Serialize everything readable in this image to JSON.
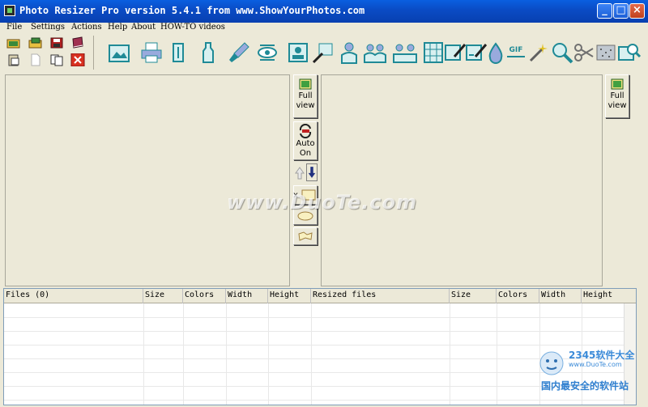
{
  "window": {
    "title": "Photo Resizer Pro version 5.4.1 from www.ShowYourPhotos.com",
    "controls": {
      "minimize": "_",
      "maximize": "□",
      "close": "×"
    }
  },
  "menu": {
    "items": [
      {
        "label": "File",
        "mnemonic": "F"
      },
      {
        "label": "Settings",
        "mnemonic": "S"
      },
      {
        "label": "Actions",
        "mnemonic": "A"
      },
      {
        "label": "Help",
        "mnemonic": "H"
      },
      {
        "label": "About",
        "mnemonic": "A"
      },
      {
        "label": "HOW-TO videos",
        "mnemonic": "H"
      }
    ]
  },
  "toolbar": {
    "small_icons": [
      "open-folder-icon",
      "open-multiple-icon",
      "save-icon",
      "book-icon",
      "paste-icon",
      "new-file-icon",
      "copy-icon",
      "delete-icon"
    ],
    "big_icons": [
      "picture-frame-icon",
      "printer-icon",
      "resize-vertical-icon",
      "bottle-icon",
      "brush-icon",
      "rotate-eye-icon",
      "photo-adjust-icon",
      "photo-edit-icon",
      "people-icon",
      "group-photo-icon",
      "group-photo-wide-icon",
      "grid-photo-icon",
      "sign-photo-icon",
      "sign-photo-alt-icon",
      "droplet-icon",
      "gif-icon",
      "wand-icon",
      "zoom-icon",
      "scissors-icon",
      "noise-icon",
      "zoom-photo-icon"
    ]
  },
  "mid_buttons": {
    "full_view_line1": "Full",
    "full_view_line2": "view",
    "auto_line1": "Auto",
    "auto_line2": "On",
    "x_label": "x",
    "right_full_view_line1": "Full",
    "right_full_view_line2": "view"
  },
  "table": {
    "left_columns": [
      "Files (0)",
      "Size",
      "Colors",
      "Width",
      "Height"
    ],
    "right_columns": [
      "Resized files",
      "Size",
      "Colors",
      "Width",
      "Height"
    ]
  },
  "watermark": {
    "site": "www.DuoTe.com",
    "logo_line1": "2345软件大全",
    "logo_line2": "www.DuoTe.com",
    "logo_line3": "国内最安全的软件站"
  },
  "colors": {
    "titlebar": "#0a4bc4",
    "background": "#ece9d8",
    "icon_teal": "#1f8a96",
    "icon_red": "#c03020"
  }
}
